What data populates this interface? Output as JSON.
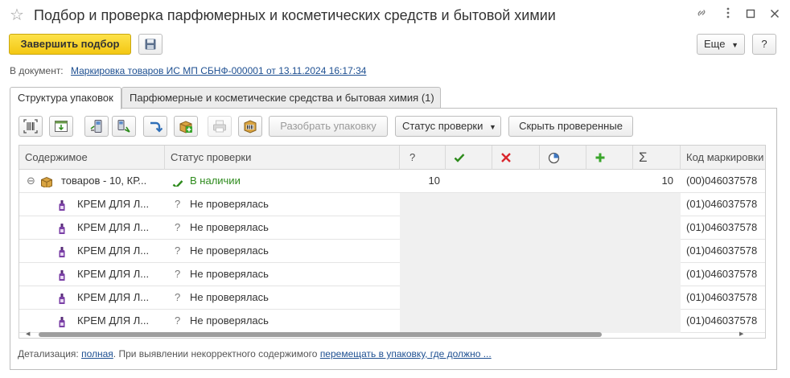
{
  "window": {
    "title": "Подбор и проверка парфюмерных и косметических средств и бытовой химии"
  },
  "toolbar": {
    "finish_label": "Завершить подбор",
    "more_label": "Еще",
    "help_label": "?"
  },
  "document": {
    "label": "В документ:",
    "link_text": "Маркировка товаров ИС МП СБНФ-000001 от 13.11.2024 16:17:34"
  },
  "tabs": [
    {
      "label": "Структура упаковок",
      "active": true
    },
    {
      "label": "Парфюмерные и косметические средства и бытовая химия (1)",
      "active": false
    }
  ],
  "panel_toolbar": {
    "unpack_label": "Разобрать упаковку",
    "check_status_label": "Статус проверки",
    "hide_checked_label": "Скрыть проверенные"
  },
  "grid": {
    "columns": {
      "content": "Содержимое",
      "status": "Статус проверки",
      "unknown": "?",
      "sum": "Σ",
      "code": "Код маркировки"
    },
    "rows": [
      {
        "content": "товаров - 10, КР...",
        "status": "В наличии",
        "status_icon": "check-icon",
        "unknown": "10",
        "sum": "10",
        "code": "(00)046037578",
        "level": 0
      },
      {
        "content": "КРЕМ ДЛЯ Л...",
        "status": "Не проверялась",
        "status_icon": "question-icon",
        "unknown": "",
        "sum": "",
        "code": "(01)046037578",
        "level": 1
      },
      {
        "content": "КРЕМ ДЛЯ Л...",
        "status": "Не проверялась",
        "status_icon": "question-icon",
        "unknown": "",
        "sum": "",
        "code": "(01)046037578",
        "level": 1
      },
      {
        "content": "КРЕМ ДЛЯ Л...",
        "status": "Не проверялась",
        "status_icon": "question-icon",
        "unknown": "",
        "sum": "",
        "code": "(01)046037578",
        "level": 1
      },
      {
        "content": "КРЕМ ДЛЯ Л...",
        "status": "Не проверялась",
        "status_icon": "question-icon",
        "unknown": "",
        "sum": "",
        "code": "(01)046037578",
        "level": 1
      },
      {
        "content": "КРЕМ ДЛЯ Л...",
        "status": "Не проверялась",
        "status_icon": "question-icon",
        "unknown": "",
        "sum": "",
        "code": "(01)046037578",
        "level": 1
      },
      {
        "content": "КРЕМ ДЛЯ Л...",
        "status": "Не проверялась",
        "status_icon": "question-icon",
        "unknown": "",
        "sum": "",
        "code": "(01)046037578",
        "level": 1
      }
    ]
  },
  "footer": {
    "detail_label": "Детализация:",
    "detail_link": "полная",
    "text": ". При выявлении некорректного содержимого",
    "action_link": "перемещать в упаковку, где должно ..."
  },
  "colors": {
    "primary_button": "#f3c713",
    "link": "#1d4f91",
    "ok_status": "#2e8b1d",
    "error_icon": "#d9262c",
    "plus_icon": "#3aa52b"
  }
}
